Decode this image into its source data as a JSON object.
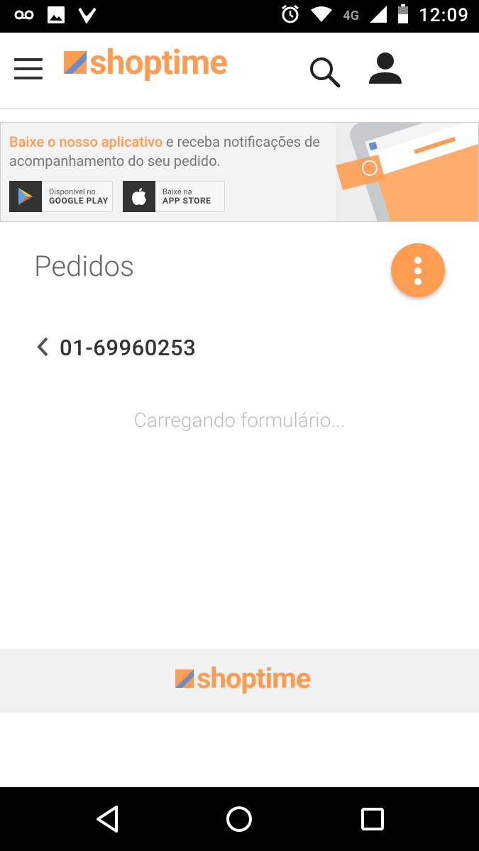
{
  "status_bar": {
    "time": "12:09",
    "network": "4G",
    "icons": [
      "voicemail-icon",
      "image-icon",
      "check-icon",
      "alarm-icon",
      "wifi-icon",
      "signal-icon",
      "battery-icon"
    ]
  },
  "header": {
    "brand": "shoptime",
    "menu_icon": "hamburger-icon",
    "search_icon": "search-icon",
    "account_icon": "user-icon"
  },
  "banner": {
    "highlight": "Baixe o nosso aplicativo",
    "text": " e receba notificações de acompanhamento do seu pedido.",
    "google_play": {
      "small": "Disponível no",
      "big": "GOOGLE PLAY"
    },
    "app_store": {
      "small": "Baixe na",
      "big": "APP STORE"
    }
  },
  "main": {
    "title": "Pedidos",
    "order_number": "01-69960253",
    "loading_text": "Carregando formulário..."
  },
  "footer": {
    "brand": "shoptime"
  },
  "colors": {
    "brand_orange": "#fe9d51",
    "brand_blue": "#6e8bc9",
    "text_dark": "#333333"
  }
}
